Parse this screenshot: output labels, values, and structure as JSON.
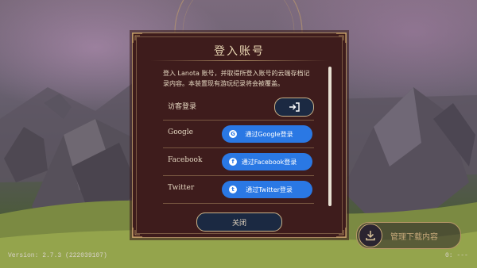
{
  "background": {
    "version_text": "Version: 2.7.3 (222039107)",
    "right_status": "0: ---"
  },
  "manage_download": {
    "label": "管理下载内容",
    "icon": "download-icon"
  },
  "dialog": {
    "title": "登入账号",
    "description": "登入 Lanota 账号，并取得所登入账号的云端存档记录内容。本装置现有游玩纪录将会被覆盖。",
    "guest": {
      "label": "访客登录",
      "icon": "login-arrow-icon"
    },
    "google": {
      "label": "Google",
      "button": "通过Google登录",
      "icon": "google-icon"
    },
    "facebook": {
      "label": "Facebook",
      "button": "通过Facebook登录",
      "icon": "facebook-icon"
    },
    "twitter": {
      "label": "Twitter",
      "button": "通过Twitter登录",
      "icon": "twitter-icon"
    },
    "close": "关闭"
  },
  "colors": {
    "dialog_bg": "#3e1c1c",
    "gold": "#a88860",
    "sso_blue": "#2a78e4",
    "dark_button": "#1b2942"
  }
}
